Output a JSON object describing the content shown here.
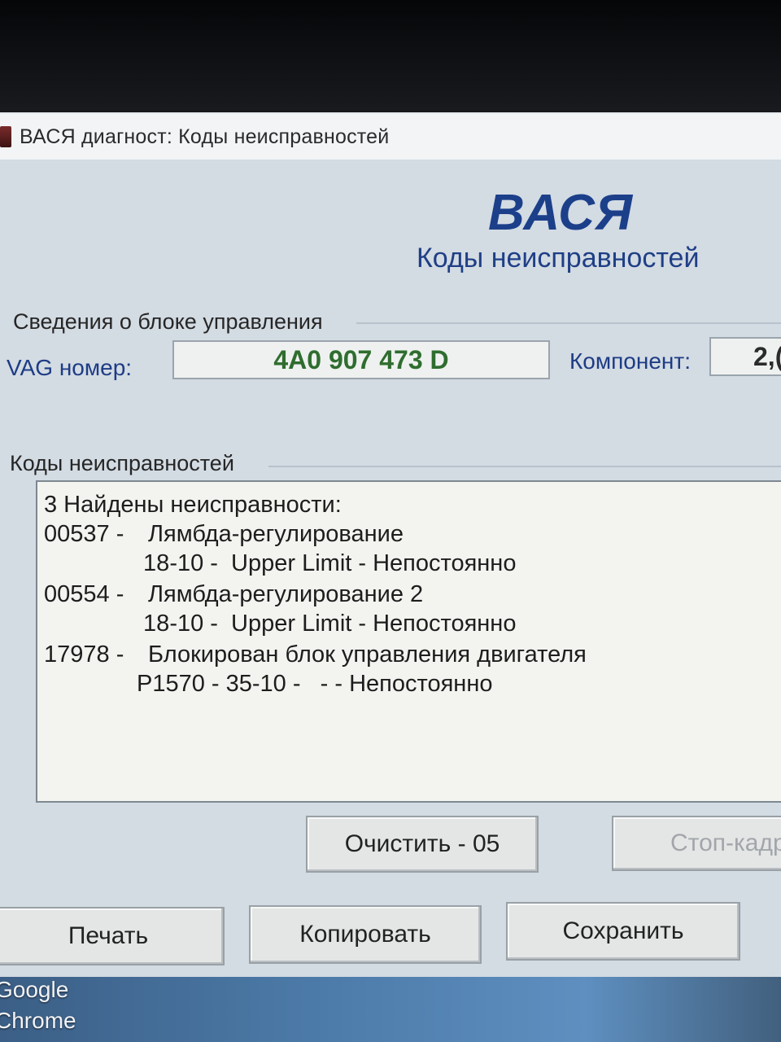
{
  "window": {
    "title": "ВАСЯ диагност: Коды неисправностей"
  },
  "brand": {
    "name": "ВАСЯ",
    "subtitle": "Коды неисправностей"
  },
  "control_info": {
    "section_title": "Сведения о блоке управления",
    "vag_label": "VAG номер:",
    "vag_value": "4A0 907 473 D",
    "component_label": "Компонент:",
    "component_value": "2,("
  },
  "faults": {
    "section_title": "Коды неисправностей",
    "header": "3 Найдены неисправности:",
    "items": [
      {
        "code": "00537 -",
        "description": "Лямбда-регулирование",
        "detail": " 18-10 -  Upper Limit - Непостоянно"
      },
      {
        "code": "00554 -",
        "description": "Лямбда-регулирование 2",
        "detail": " 18-10 -  Upper Limit - Непостоянно"
      },
      {
        "code": "17978 -",
        "description": "Блокирован блок управления двигателя",
        "detail": "P1570 - 35-10 -   - - Непостоянно"
      }
    ]
  },
  "buttons": {
    "clear": "Очистить - 05",
    "freeze_frame": "Стоп-кадр",
    "print": "Печать",
    "copy": "Копировать",
    "save": "Сохранить"
  },
  "desktop": {
    "shortcut_line1": "Google",
    "shortcut_line2": "Chrome"
  }
}
